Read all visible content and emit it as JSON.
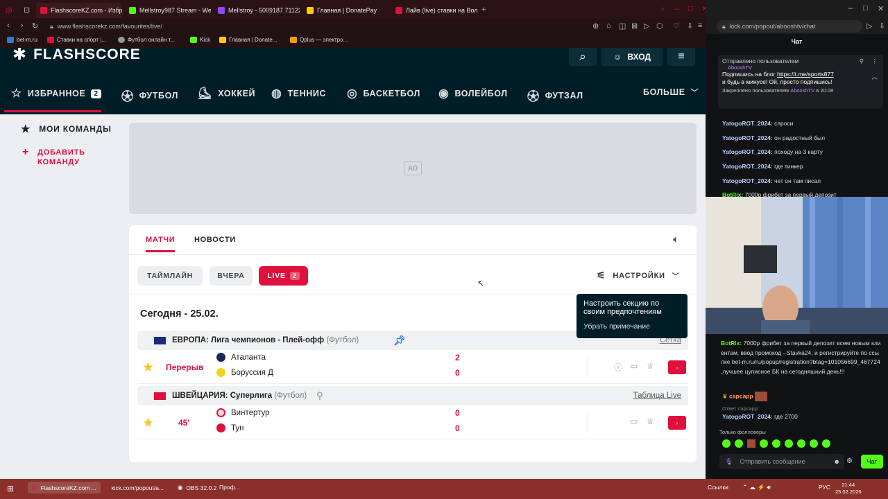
{
  "browser": {
    "tabs": [
      {
        "label": "FlashscoreKZ.com - Избр",
        "color": "#e0103d"
      },
      {
        "label": "Mellstroy987 Stream - We",
        "color": "#53fc18"
      },
      {
        "label": "Mellstroy - 5009187.71122",
        "color": "#9146ff"
      },
      {
        "label": "Главная | DonatePay",
        "color": "#ffcc00"
      },
      {
        "label": "Лайв (live) ставки на Вол",
        "color": "#e0103d"
      }
    ],
    "url": "www.flashscorekz.com/favourites/live/",
    "chat_url": "kick.com/popout/abooshtv/chat",
    "bookmarks": [
      {
        "label": "bet-m.ru"
      },
      {
        "label": "Ставки на спорт |..."
      },
      {
        "label": "Футбол онлайн т..."
      },
      {
        "label": "Kick"
      },
      {
        "label": "Главная | Donate..."
      },
      {
        "label": "Qplus — электро..."
      }
    ]
  },
  "flashscore": {
    "logo": "FLASHSCORE",
    "login": "ВХОД",
    "nav": [
      {
        "label": "ИЗБРАННОЕ",
        "badge": "2"
      },
      {
        "label": "ФУТБОЛ"
      },
      {
        "label": "ХОККЕЙ"
      },
      {
        "label": "ТЕННИС"
      },
      {
        "label": "БАСКЕТБОЛ"
      },
      {
        "label": "ВОЛЕЙБОЛ"
      },
      {
        "label": "ФУТЗАЛ"
      }
    ],
    "more": "БОЛЬШЕ",
    "my_teams": "МОИ КОМАНДЫ",
    "add_team": "ДОБАВИТЬ КОМАНДУ",
    "ad": "AD",
    "tabs": {
      "matches": "МАТЧИ",
      "news": "НОВОСТИ"
    },
    "filters": {
      "timeline": "ТАЙМЛАЙН",
      "yesterday": "ВЧЕРА",
      "live": "LIVE",
      "live_count": "2"
    },
    "settings": "НАСТРОЙКИ",
    "tooltip": {
      "title": "Настроить секцию по своим предпочтениям",
      "dismiss": "Убрать примечание"
    },
    "date": "Сегодня - 25.02.",
    "leagues": [
      {
        "country": "ЕВРОПА:",
        "name": "Лига чемпионов - Плей-офф",
        "sport": "(Футбол)",
        "link": "Сетка",
        "match": {
          "status": "Перерыв",
          "home": "Аталанта",
          "away": "Боруссия Д",
          "home_score": "2",
          "away_score": "0"
        }
      },
      {
        "country": "ШВЕЙЦАРИЯ:",
        "name": "Суперлига",
        "sport": "(Футбол)",
        "link": "Таблица Live",
        "match": {
          "status": "45'",
          "home": "Винтертур",
          "away": "Тун",
          "home_score": "0",
          "away_score": "0"
        }
      }
    ]
  },
  "chat": {
    "title": "Чат",
    "pinned_header": "Отправлено пользователем",
    "pinned_user": "AbooshTV",
    "pinned_text1": "Подпишись на блог ",
    "pinned_link": "https://t.me/sports877",
    "pinned_text2": "и будь в минусе! Ой, просто подпишись!",
    "pinned_footer": "Закреплено пользователем",
    "pinned_time": "в 20:08",
    "messages": [
      {
        "user": "YatogoROT_2024:",
        "text": "спроси"
      },
      {
        "user": "YatogoROT_2024:",
        "text": "он радостный был"
      },
      {
        "user": "YatogoROT_2024:",
        "text": "походу на 3 карту"
      },
      {
        "user": "YatogoROT_2024:",
        "text": "где тинкер"
      },
      {
        "user": "YatogoROT_2024:",
        "text": "чет он там писал"
      },
      {
        "user": "BotRix:",
        "text": "7000р фрибет за первый депозит"
      }
    ],
    "bot_user": "BotRix:",
    "bot_message": "7000р фрибет за первый депозит всем новым клиентам, ввод промокод - Stavka24, и регистрируйте по ссылке bet-m.ru/ru/popup/registration?btag=101056699_467724 ,лучшее цуписное БК на сегодняшний день!!!",
    "msg2_user": "сарсарр",
    "reply_label": "Ответ сарсарр:",
    "msg3_user": "YatogoROT_2024:",
    "msg3_text": "где 2700",
    "followers_only": "Только фолловеры",
    "input_placeholder": "Отправить сообщение",
    "send": "Чат"
  },
  "taskbar": {
    "items": [
      {
        "label": "FlashscoreKZ.com ..."
      },
      {
        "label": "kick.com/popout/a..."
      },
      {
        "label": "OBS 32.0.2"
      },
      {
        "label": "Проф..."
      }
    ],
    "links": "Ссылки",
    "lang": "РУС",
    "time": "21:44",
    "date": "25.02.2026"
  }
}
